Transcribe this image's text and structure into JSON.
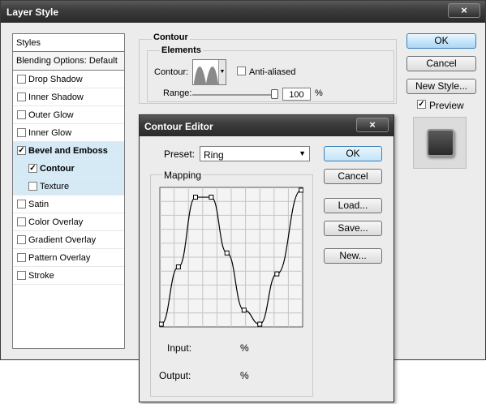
{
  "layer_style": {
    "title": "Layer Style",
    "close_glyph": "×",
    "styles_header": "Styles",
    "blending_options": "Blending Options: Default",
    "items": [
      {
        "label": "Drop Shadow",
        "checked": false
      },
      {
        "label": "Inner Shadow",
        "checked": false
      },
      {
        "label": "Outer Glow",
        "checked": false
      },
      {
        "label": "Inner Glow",
        "checked": false
      },
      {
        "label": "Bevel and Emboss",
        "checked": true
      },
      {
        "label": "Contour",
        "checked": true
      },
      {
        "label": "Texture",
        "checked": false
      },
      {
        "label": "Satin",
        "checked": false
      },
      {
        "label": "Color Overlay",
        "checked": false
      },
      {
        "label": "Gradient Overlay",
        "checked": false
      },
      {
        "label": "Pattern Overlay",
        "checked": false
      },
      {
        "label": "Stroke",
        "checked": false
      }
    ],
    "checkmark": "✓",
    "contour_section": {
      "title": "Contour",
      "group": "Elements",
      "contour_label": "Contour:",
      "anti_aliased": "Anti-aliased",
      "range_label": "Range:",
      "range_value": "100",
      "range_unit": "%"
    },
    "buttons": {
      "ok": "OK",
      "cancel": "Cancel",
      "new_style": "New Style...",
      "preview": "Preview"
    }
  },
  "contour_editor": {
    "title": "Contour Editor",
    "close_glyph": "×",
    "preset_label": "Preset:",
    "preset_value": "Ring",
    "dropdown_glyph": "▼",
    "mapping_label": "Mapping",
    "input_label": "Input:",
    "input_unit": "%",
    "output_label": "Output:",
    "output_unit": "%",
    "buttons": {
      "ok": "OK",
      "cancel": "Cancel",
      "load": "Load...",
      "save": "Save...",
      "new": "New..."
    }
  }
}
